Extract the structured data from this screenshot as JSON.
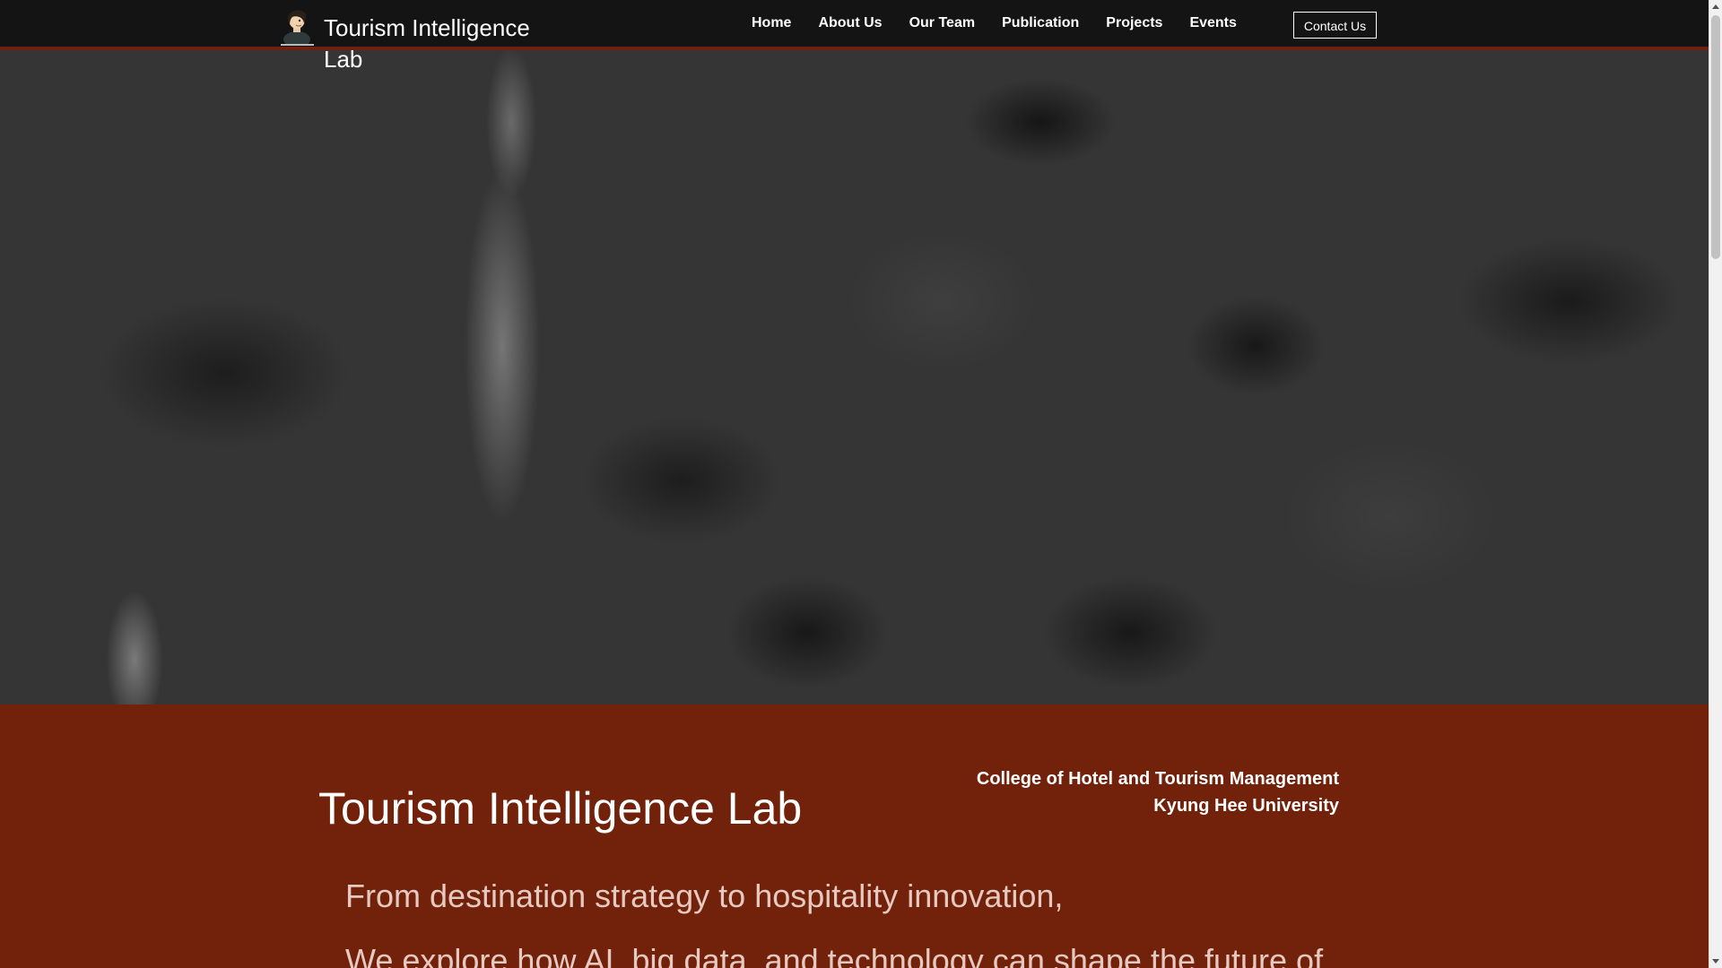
{
  "header": {
    "site_title": "Tourism Intelligence Lab",
    "nav": [
      "Home",
      "About Us",
      "Our Team",
      "Publication",
      "Projects",
      "Events"
    ],
    "contact_label": "Contact Us",
    "logo_icon": "person-avatar-icon"
  },
  "intro": {
    "title": "Tourism Intelligence Lab",
    "affiliation_line1": "College of Hotel and Tourism Management",
    "affiliation_line2": "Kyung Hee University",
    "text_line1": "From destination strategy to hospitality innovation,",
    "text_line2": "We explore how AI, big data, and technology can shape the future of"
  },
  "colors": {
    "accent": "#72210a",
    "header_bg": "#141414",
    "hero_bg": "#353535"
  }
}
